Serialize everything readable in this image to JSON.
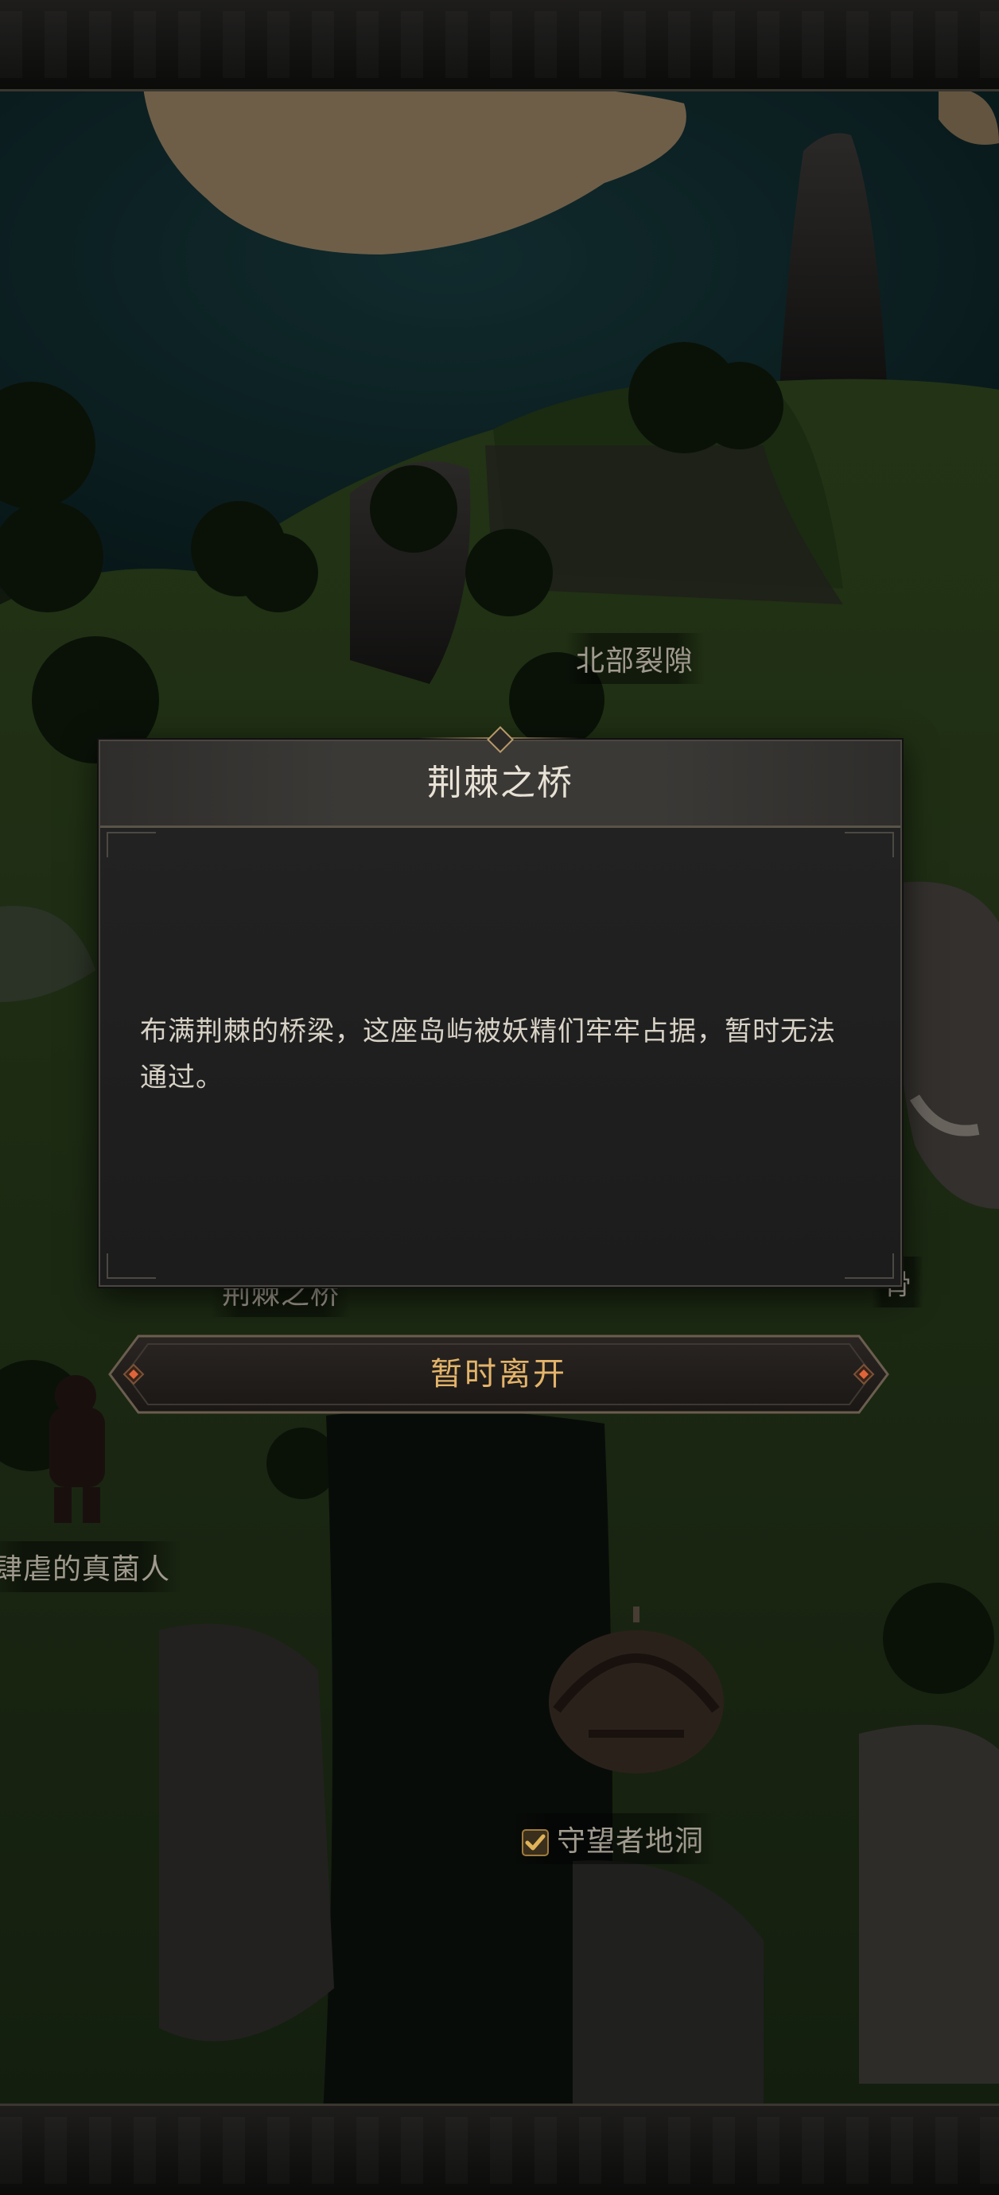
{
  "map": {
    "locations": [
      {
        "name": "北部裂隙",
        "completed": false
      },
      {
        "name": "荆棘之桥",
        "completed": false
      },
      {
        "name": "骨",
        "completed": false
      },
      {
        "name": "肆虐的真菌人",
        "completed": false
      },
      {
        "name": "守望者地洞",
        "completed": true
      }
    ]
  },
  "dialog": {
    "title": "荆棘之桥",
    "description": "布满荆棘的桥梁，这座岛屿被妖精们牢牢占据，暂时无法通过。"
  },
  "actions": {
    "leave_label": "暂时离开"
  },
  "colors": {
    "accent_gold": "#e3b46a",
    "dialog_bg": "#1f1f1f",
    "ornament_orange": "#e0643a"
  }
}
